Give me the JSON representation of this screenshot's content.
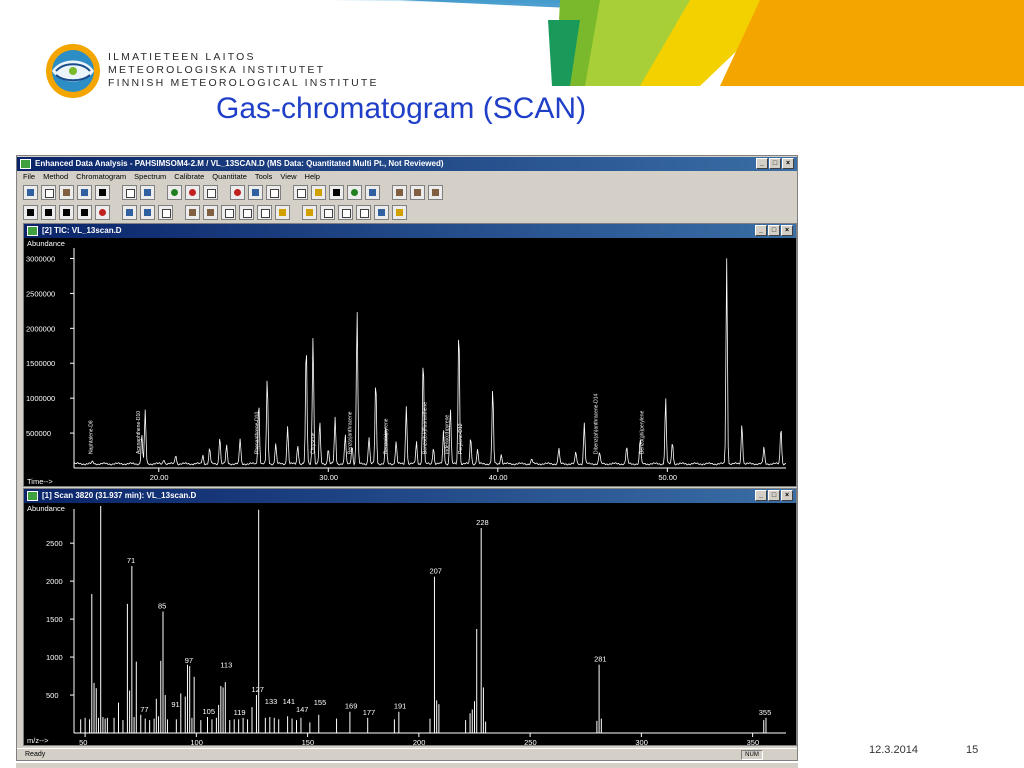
{
  "slide": {
    "logo_lines": [
      "ILMATIETEEN LAITOS",
      "METEOROLOGISKA INSTITUTET",
      "FINNISH METEOROLOGICAL INSTITUTE"
    ],
    "title": "Gas-chromatogram (SCAN)",
    "footer_date": "12.3.2014",
    "footer_page": "15",
    "colors": {
      "title": "#1f3fc8",
      "banner_green": "#7ab92b",
      "banner_yellow": "#f3d000",
      "banner_orange": "#f4a500",
      "banner_blue": "#2d8ec6"
    }
  },
  "app": {
    "title": "Enhanced Data Analysis - PAHSIMSOM4-2.M / VL_13SCAN.D    (MS Data: Quantitated Multi Pt., Not Reviewed)",
    "window_buttons": [
      "_",
      "□",
      "×"
    ],
    "menu": [
      "File",
      "Method",
      "Chromatogram",
      "Spectrum",
      "Calibrate",
      "Quantitate",
      "Tools",
      "View",
      "Help"
    ],
    "status_left": "Ready",
    "status_num": "NUM"
  },
  "tic_window": {
    "title": "[2] TIC: VL_13scan.D",
    "ylabel": "Abundance",
    "xlabel": "Time-->"
  },
  "scan_window": {
    "title": "[1] Scan 3820 (31.937 min): VL_13scan.D",
    "ylabel": "Abundance",
    "xlabel": "m/z-->"
  },
  "chart_data": [
    {
      "type": "line",
      "name": "TIC chromatogram",
      "ylabel": "Abundance",
      "xlabel": "Time-->",
      "xlim": [
        15.0,
        57.0
      ],
      "ylim": [
        0,
        3150000
      ],
      "x_ticks": [
        20.0,
        30.0,
        40.0,
        50.0
      ],
      "x_tick_labels": [
        "20.00",
        "30.00",
        "40.00",
        "50.00"
      ],
      "y_ticks": [
        500000,
        1000000,
        1500000,
        2000000,
        2500000,
        3000000
      ],
      "baseline": 60000,
      "peaks": [
        {
          "x": 16.1,
          "y": 90000
        },
        {
          "x": 19.0,
          "y": 480000
        },
        {
          "x": 19.2,
          "y": 820000
        },
        {
          "x": 20.3,
          "y": 130000
        },
        {
          "x": 21.0,
          "y": 190000
        },
        {
          "x": 22.6,
          "y": 190000
        },
        {
          "x": 23.0,
          "y": 280000
        },
        {
          "x": 23.6,
          "y": 450000
        },
        {
          "x": 24.0,
          "y": 320000
        },
        {
          "x": 24.8,
          "y": 420000
        },
        {
          "x": 25.9,
          "y": 960000
        },
        {
          "x": 26.4,
          "y": 1300000
        },
        {
          "x": 26.9,
          "y": 350000
        },
        {
          "x": 27.6,
          "y": 600000
        },
        {
          "x": 28.2,
          "y": 330000
        },
        {
          "x": 28.7,
          "y": 1790000
        },
        {
          "x": 29.1,
          "y": 1900000
        },
        {
          "x": 29.5,
          "y": 660000
        },
        {
          "x": 30.0,
          "y": 280000
        },
        {
          "x": 30.4,
          "y": 720000
        },
        {
          "x": 31.0,
          "y": 480000
        },
        {
          "x": 31.4,
          "y": 330000
        },
        {
          "x": 31.7,
          "y": 2260000
        },
        {
          "x": 32.4,
          "y": 450000
        },
        {
          "x": 32.8,
          "y": 1270000
        },
        {
          "x": 33.4,
          "y": 600000
        },
        {
          "x": 34.0,
          "y": 380000
        },
        {
          "x": 34.6,
          "y": 900000
        },
        {
          "x": 35.2,
          "y": 380000
        },
        {
          "x": 35.6,
          "y": 1590000
        },
        {
          "x": 36.2,
          "y": 300000
        },
        {
          "x": 36.8,
          "y": 540000
        },
        {
          "x": 37.2,
          "y": 880000
        },
        {
          "x": 37.7,
          "y": 2050000
        },
        {
          "x": 38.4,
          "y": 450000
        },
        {
          "x": 38.8,
          "y": 270000
        },
        {
          "x": 39.7,
          "y": 1140000
        },
        {
          "x": 40.2,
          "y": 200000
        },
        {
          "x": 42.0,
          "y": 130000
        },
        {
          "x": 43.6,
          "y": 290000
        },
        {
          "x": 44.6,
          "y": 230000
        },
        {
          "x": 45.1,
          "y": 650000
        },
        {
          "x": 46.0,
          "y": 230000
        },
        {
          "x": 47.6,
          "y": 300000
        },
        {
          "x": 48.4,
          "y": 420000
        },
        {
          "x": 49.9,
          "y": 1000000
        },
        {
          "x": 50.3,
          "y": 380000
        },
        {
          "x": 53.5,
          "y": 3000000
        },
        {
          "x": 54.4,
          "y": 640000
        },
        {
          "x": 55.7,
          "y": 300000
        },
        {
          "x": 56.7,
          "y": 600000
        }
      ],
      "annotations": [
        {
          "x": 16.2,
          "text": "Naphtalene-D8"
        },
        {
          "x": 19.0,
          "text": "Acenaphthene-D10"
        },
        {
          "x": 26.0,
          "text": "Phenanthrene-D10"
        },
        {
          "x": 29.3,
          "text": "Chrysene"
        },
        {
          "x": 31.5,
          "text": "Benz(a)anthracene"
        },
        {
          "x": 33.6,
          "text": "Benzo(a)pyrene"
        },
        {
          "x": 35.9,
          "text": "Benzo(b,k)fluoranthene"
        },
        {
          "x": 37.2,
          "text": "Indeno(cd)pyrene"
        },
        {
          "x": 38.0,
          "text": "Perylene-D12"
        },
        {
          "x": 46.0,
          "text": "Dibenz(ah)anthracene-D14"
        },
        {
          "x": 48.7,
          "text": "Benzo(ghi)perylene"
        }
      ]
    },
    {
      "type": "bar",
      "name": "Mass spectrum, scan 3820",
      "ylabel": "Abundance",
      "xlabel": "m/z-->",
      "xlim": [
        45,
        365
      ],
      "ylim": [
        0,
        2950
      ],
      "x_ticks": [
        50,
        100,
        150,
        200,
        250,
        300,
        350
      ],
      "y_ticks": [
        500,
        1000,
        1500,
        2000,
        2500
      ],
      "x": [
        48,
        50,
        52,
        53,
        54,
        55,
        56,
        57,
        58,
        59,
        60,
        63,
        65,
        67,
        69,
        70,
        71,
        72,
        73,
        75,
        77,
        79,
        81,
        82,
        83,
        84,
        85,
        86,
        87,
        91,
        93,
        95,
        96,
        97,
        98,
        99,
        102,
        105,
        107,
        109,
        110,
        111,
        112,
        113,
        115,
        117,
        119,
        121,
        123,
        125,
        127,
        128,
        131,
        133,
        135,
        137,
        141,
        143,
        145,
        147,
        151,
        155,
        163,
        169,
        177,
        189,
        191,
        205,
        207,
        208,
        209,
        221,
        223,
        224,
        225,
        226,
        228,
        229,
        230,
        280,
        281,
        282,
        355,
        356
      ],
      "values": [
        180,
        200,
        180,
        1830,
        660,
        590,
        200,
        2990,
        210,
        190,
        200,
        200,
        400,
        170,
        1700,
        560,
        2200,
        210,
        940,
        240,
        190,
        170,
        190,
        450,
        220,
        950,
        1600,
        500,
        180,
        180,
        520,
        480,
        900,
        880,
        200,
        740,
        170,
        210,
        180,
        200,
        370,
        620,
        600,
        670,
        170,
        180,
        180,
        200,
        180,
        340,
        500,
        2940,
        200,
        210,
        200,
        180,
        220,
        190,
        170,
        200,
        140,
        240,
        190,
        280,
        200,
        180,
        280,
        190,
        2060,
        430,
        380,
        170,
        260,
        310,
        420,
        1370,
        2700,
        600,
        150,
        160,
        900,
        190,
        170,
        200
      ],
      "peak_labels": [
        {
          "x": 57,
          "text": "57"
        },
        {
          "x": 71,
          "text": "71"
        },
        {
          "x": 77,
          "text": "77"
        },
        {
          "x": 85,
          "text": "85"
        },
        {
          "x": 91,
          "text": "91"
        },
        {
          "x": 97,
          "text": "97"
        },
        {
          "x": 105,
          "text": "105"
        },
        {
          "x": 113,
          "text": "113"
        },
        {
          "x": 119,
          "text": "119"
        },
        {
          "x": 127,
          "text": "127"
        },
        {
          "x": 133,
          "text": "133"
        },
        {
          "x": 141,
          "text": "141"
        },
        {
          "x": 147,
          "text": "147"
        },
        {
          "x": 155,
          "text": "155"
        },
        {
          "x": 169,
          "text": "169"
        },
        {
          "x": 177,
          "text": "177"
        },
        {
          "x": 191,
          "text": "191"
        },
        {
          "x": 207,
          "text": "207"
        },
        {
          "x": 228,
          "text": "228"
        },
        {
          "x": 281,
          "text": "281"
        },
        {
          "x": 355,
          "text": "355"
        }
      ],
      "label_heights": {
        "57": 2990,
        "71": 2200,
        "77": 240,
        "85": 1600,
        "91": 300,
        "97": 880,
        "105": 210,
        "113": 820,
        "119": 200,
        "127": 500,
        "133": 340,
        "141": 340,
        "147": 240,
        "155": 330,
        "169": 280,
        "177": 200,
        "191": 280,
        "207": 2060,
        "228": 2700,
        "281": 900,
        "355": 200
      }
    }
  ]
}
